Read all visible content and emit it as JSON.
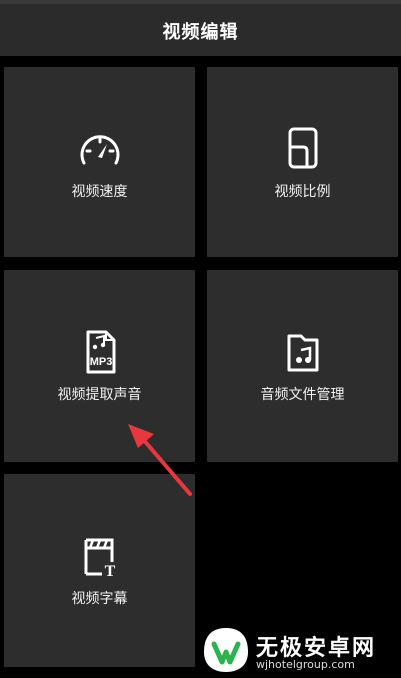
{
  "header": {
    "title": "视频编辑"
  },
  "tiles": [
    {
      "label": "视频速度",
      "icon": "speedometer-icon"
    },
    {
      "label": "视频比例",
      "icon": "aspect-ratio-icon"
    },
    {
      "label": "视频提取声音",
      "icon": "mp3-file-icon",
      "icon_text": "MP3"
    },
    {
      "label": "音频文件管理",
      "icon": "music-folder-icon"
    },
    {
      "label": "视频字幕",
      "icon": "subtitle-clapper-icon",
      "icon_text": "T"
    }
  ],
  "watermark": {
    "text": "无极安卓网",
    "url": "wjhotelgroup.com"
  },
  "colors": {
    "background": "#000000",
    "header": "#2b2b2b",
    "tile": "#2d2d2d",
    "arrow": "#e8383d",
    "text": "#ffffff"
  }
}
